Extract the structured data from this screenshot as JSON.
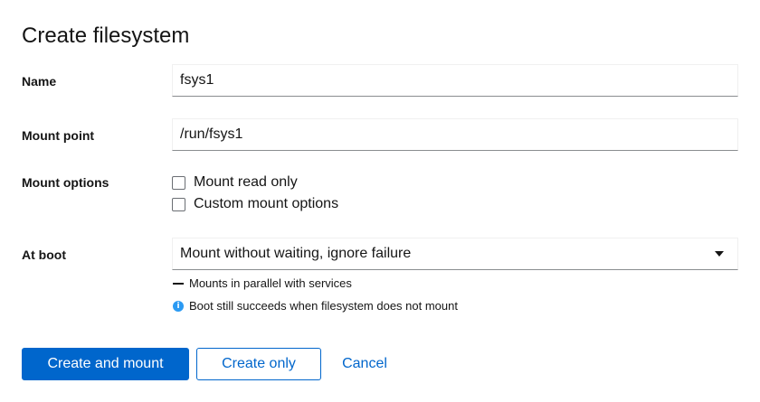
{
  "dialog": {
    "title": "Create filesystem"
  },
  "form": {
    "name": {
      "label": "Name",
      "value": "fsys1"
    },
    "mount_point": {
      "label": "Mount point",
      "value": "/run/fsys1"
    },
    "mount_options": {
      "label": "Mount options",
      "options": [
        {
          "label": "Mount read only",
          "checked": false
        },
        {
          "label": "Custom mount options",
          "checked": false
        }
      ]
    },
    "at_boot": {
      "label": "At boot",
      "selected": "Mount without waiting, ignore failure",
      "helper_lines": [
        {
          "icon": "dash-icon",
          "text": "Mounts in parallel with services"
        },
        {
          "icon": "info-icon",
          "text": "Boot still succeeds when filesystem does not mount"
        }
      ]
    }
  },
  "actions": {
    "primary": "Create and mount",
    "secondary": "Create only",
    "cancel": "Cancel"
  },
  "colors": {
    "primary": "#0066cc",
    "info": "#2b9af3"
  }
}
